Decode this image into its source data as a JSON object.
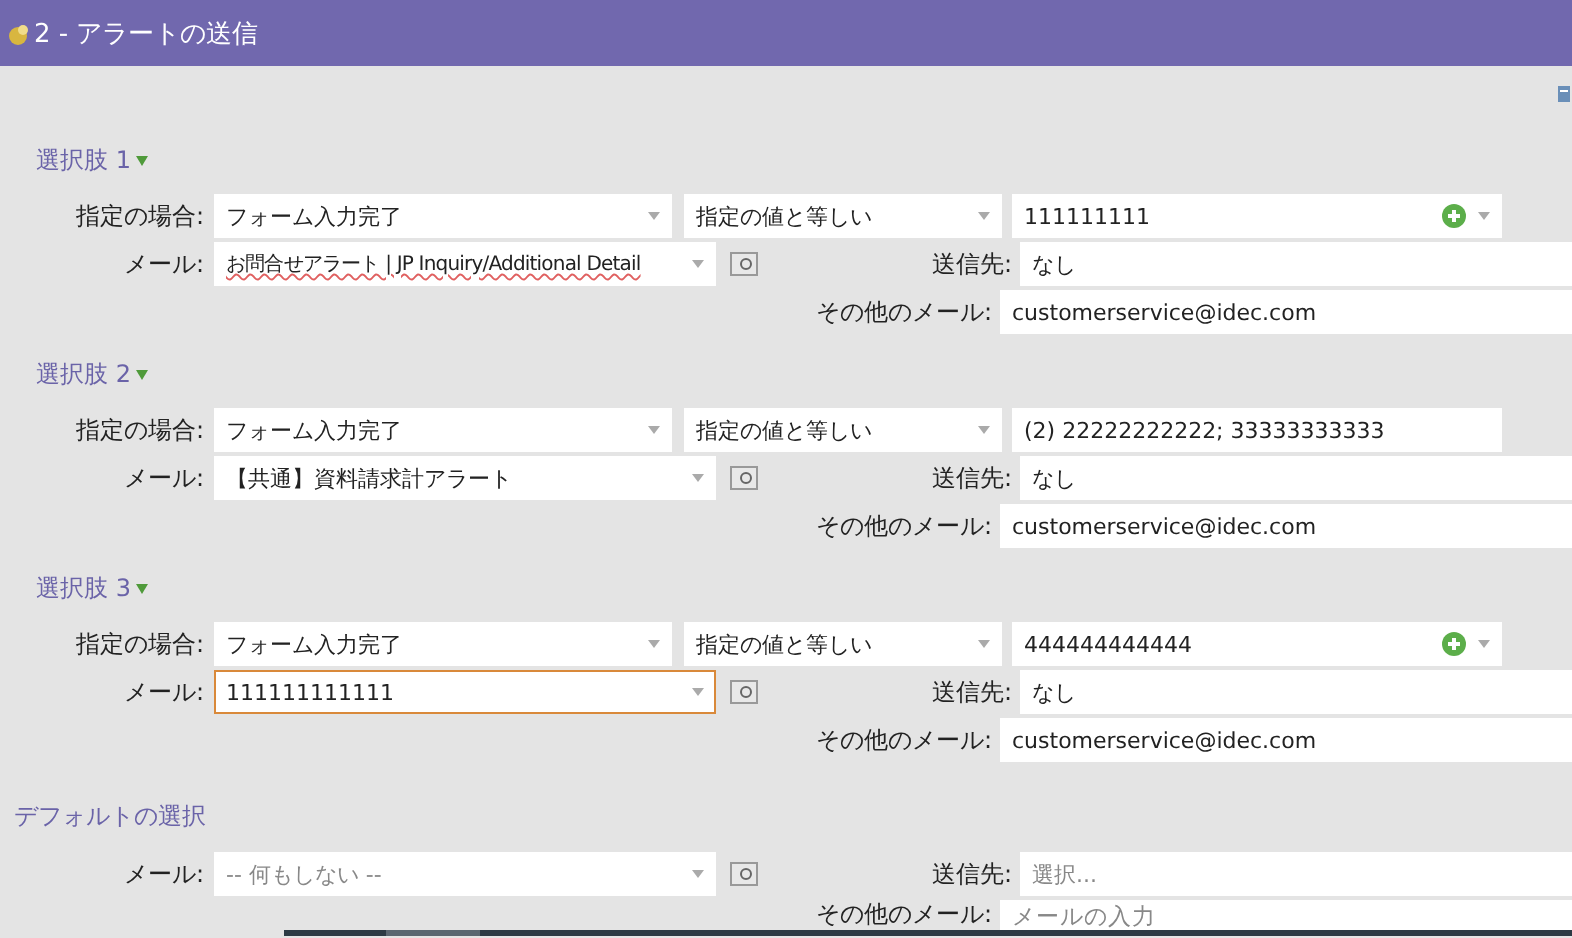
{
  "header": {
    "title": "2 - アラートの送信"
  },
  "choices": [
    {
      "title": "選択肢 1",
      "condition_label": "指定の場合:",
      "trigger": "フォーム入力完了",
      "operator": "指定の値と等しい",
      "value": "111111111",
      "has_add": true,
      "email_label": "メール:",
      "email": "お問合せアラート | JP Inquiry/Additional Detail",
      "spell_error": true,
      "focused": false,
      "send_to_label": "送信先:",
      "send_to": "なし",
      "other_email_label": "その他のメール:",
      "other_email": "customerservice@idec.com"
    },
    {
      "title": "選択肢 2",
      "condition_label": "指定の場合:",
      "trigger": "フォーム入力完了",
      "operator": "指定の値と等しい",
      "value": "(2) 22222222222; 33333333333",
      "has_add": false,
      "email_label": "メール:",
      "email": "【共通】資料請求計アラート",
      "spell_error": false,
      "focused": false,
      "send_to_label": "送信先:",
      "send_to": "なし",
      "other_email_label": "その他のメール:",
      "other_email": "customerservice@idec.com"
    },
    {
      "title": "選択肢 3",
      "condition_label": "指定の場合:",
      "trigger": "フォーム入力完了",
      "operator": "指定の値と等しい",
      "value": "444444444444",
      "has_add": true,
      "email_label": "メール:",
      "email": "111111111111",
      "spell_error": false,
      "focused": true,
      "send_to_label": "送信先:",
      "send_to": "なし",
      "other_email_label": "その他のメール:",
      "other_email": "customerservice@idec.com"
    }
  ],
  "default": {
    "title": "デフォルトの選択",
    "email_label": "メール:",
    "email_placeholder": "-- 何もしない --",
    "send_to_label": "送信先:",
    "send_to_placeholder": "選択...",
    "other_email_label": "その他のメール:",
    "other_email_placeholder": "メールの入力"
  }
}
